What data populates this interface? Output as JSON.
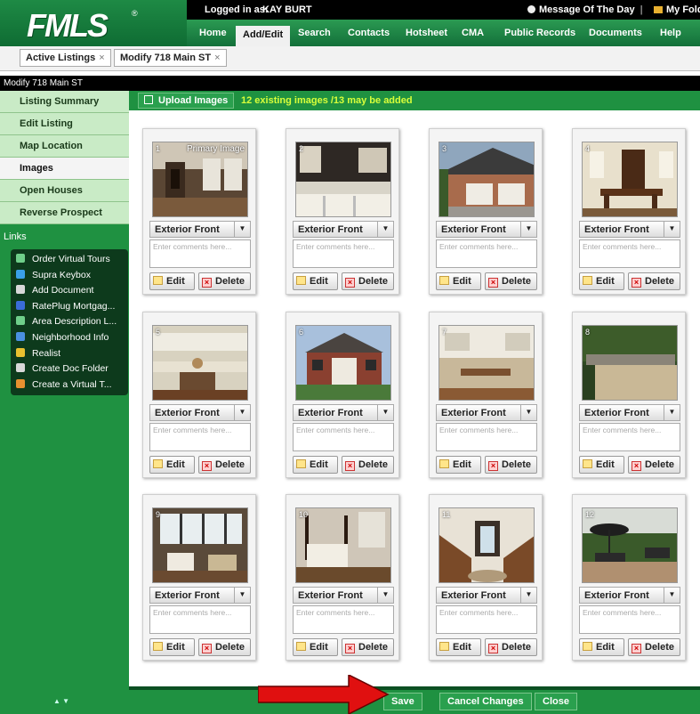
{
  "header": {
    "logo": "FMLS",
    "logo_mark": "®",
    "login_label": "Logged in as:",
    "login_user": "KAY BURT",
    "motd": "Message Of The Day",
    "myfolder": "My Folder",
    "nav": [
      "Home",
      "Add/Edit",
      "Search",
      "Contacts",
      "Hotsheet",
      "CMA",
      "Public Records",
      "Documents",
      "Help"
    ],
    "active_nav": "Add/Edit"
  },
  "tabs": [
    {
      "label": "Active Listings"
    },
    {
      "label": "Modify 718 Main ST"
    }
  ],
  "page_title": "Modify 718 Main ST",
  "sidebar": {
    "menu": [
      "Listing Summary",
      "Edit Listing",
      "Map Location",
      "Images",
      "Open Houses",
      "Reverse Prospect"
    ],
    "selected": "Images",
    "links_title": "Links",
    "links": [
      {
        "label": "Order Virtual Tours",
        "icon": "person-icon",
        "color": "#6fcf8a"
      },
      {
        "label": "Supra Keybox",
        "icon": "keybox-icon",
        "color": "#3aa0e8"
      },
      {
        "label": "Add Document",
        "icon": "document-icon",
        "color": "#d8d8d8"
      },
      {
        "label": "RatePlug Mortgag...",
        "icon": "rateplug-icon",
        "color": "#3a6cd8"
      },
      {
        "label": "Area Description L...",
        "icon": "person-icon",
        "color": "#6fcf8a"
      },
      {
        "label": "Neighborhood Info",
        "icon": "info-icon",
        "color": "#4a90e0"
      },
      {
        "label": "Realist",
        "icon": "dollar-icon",
        "color": "#e8c030"
      },
      {
        "label": "Create Doc Folder",
        "icon": "folder-icon",
        "color": "#d8d8d8"
      },
      {
        "label": "Create a Virtual T...",
        "icon": "tour-icon",
        "color": "#e89030"
      }
    ],
    "scroll": "▲ ▼"
  },
  "upload": {
    "button": "Upload Images",
    "info": "12 existing images /13 may be added"
  },
  "card_labels": {
    "category": "Exterior Front",
    "placeholder": "Enter comments here...",
    "edit": "Edit",
    "delete": "Delete",
    "primary": "Primary Image"
  },
  "images": [
    {
      "num": "1",
      "primary": "Primary Image",
      "category": "Exterior Front",
      "scene": "living-room"
    },
    {
      "num": "2",
      "primary": "",
      "category": "Exterior Front",
      "scene": "bathroom"
    },
    {
      "num": "3",
      "primary": "",
      "category": "Exterior Front",
      "scene": "garage"
    },
    {
      "num": "4",
      "primary": "",
      "category": "Exterior Front",
      "scene": "dining-room"
    },
    {
      "num": "5",
      "primary": "",
      "category": "Exterior Front",
      "scene": "kitchen"
    },
    {
      "num": "6",
      "primary": "",
      "category": "Exterior Front",
      "scene": "house-front"
    },
    {
      "num": "7",
      "primary": "",
      "category": "Exterior Front",
      "scene": "kitchen-2"
    },
    {
      "num": "8",
      "primary": "",
      "category": "Exterior Front",
      "scene": "yard"
    },
    {
      "num": "9",
      "primary": "",
      "category": "Exterior Front",
      "scene": "sunroom"
    },
    {
      "num": "10",
      "primary": "",
      "category": "Exterior Front",
      "scene": "bedroom"
    },
    {
      "num": "11",
      "primary": "",
      "category": "Exterior Front",
      "scene": "foyer"
    },
    {
      "num": "12",
      "primary": "",
      "category": "Exterior Front",
      "scene": "patio"
    }
  ],
  "footer": {
    "save": "Save",
    "cancel": "Cancel Changes",
    "close": "Close"
  },
  "colors": {
    "brand_green": "#1f9141",
    "dark_green": "#0b5a2a",
    "menu_green": "#c9ebc6",
    "highlight_yellow": "#d8ff3a",
    "arrow_red": "#e01010"
  }
}
